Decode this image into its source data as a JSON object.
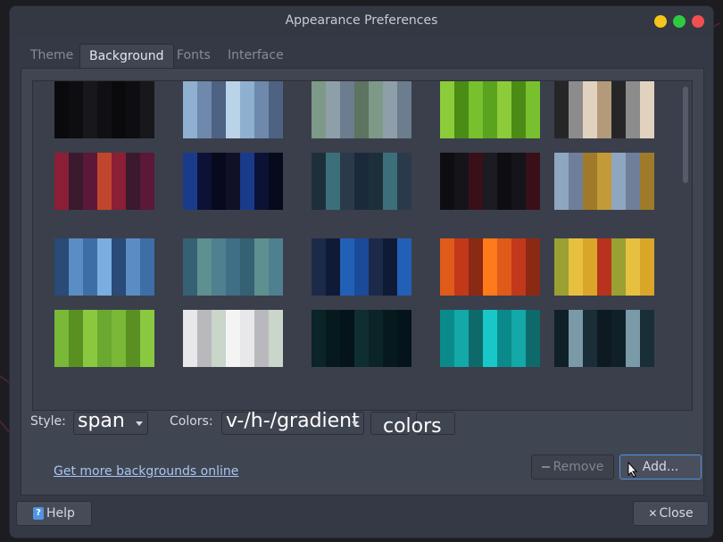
{
  "window": {
    "title": "Appearance Preferences"
  },
  "tabs": [
    {
      "label": "Theme",
      "active": false
    },
    {
      "label": "Background",
      "active": true
    },
    {
      "label": "Fonts",
      "active": false
    },
    {
      "label": "Interface",
      "active": false
    }
  ],
  "controls": {
    "style_label": "Style:",
    "style_value": "span",
    "colors_label": "Colors:",
    "colors_value": "v-/h-/gradient",
    "colors_extra": "colors"
  },
  "footer": {
    "more_link": "Get more backgrounds online",
    "remove_label": "Remove",
    "add_label": "Add...",
    "help_label": "Help",
    "close_label": "Close"
  },
  "colors": {
    "accent": "#5294e2",
    "link": "#a9c5f0",
    "window_bg": "#353945"
  },
  "icons": {
    "help": "help-icon",
    "close": "close-icon",
    "remove": "minus-icon"
  }
}
